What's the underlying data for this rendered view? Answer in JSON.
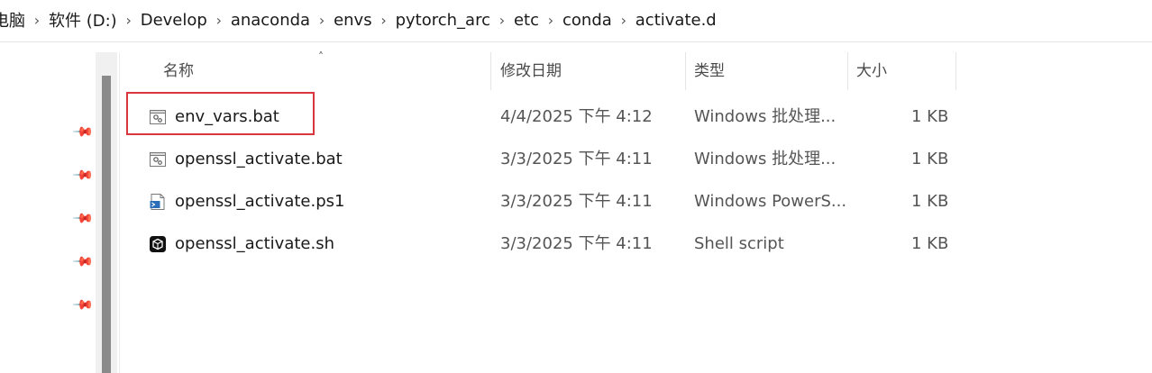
{
  "breadcrumb": {
    "items": [
      "电脑",
      "软件 (D:)",
      "Develop",
      "anaconda",
      "envs",
      "pytorch_arc",
      "etc",
      "conda",
      "activate.d"
    ],
    "separator": "›"
  },
  "columns": {
    "name": "名称",
    "modified": "修改日期",
    "type": "类型",
    "size": "大小"
  },
  "files": [
    {
      "name": "env_vars.bat",
      "modified": "4/4/2025 下午 4:12",
      "type": "Windows 批处理...",
      "size": "1 KB",
      "icon": "batch-file-icon"
    },
    {
      "name": "openssl_activate.bat",
      "modified": "3/3/2025 下午 4:11",
      "type": "Windows 批处理...",
      "size": "1 KB",
      "icon": "batch-file-icon"
    },
    {
      "name": "openssl_activate.ps1",
      "modified": "3/3/2025 下午 4:11",
      "type": "Windows PowerS...",
      "size": "1 KB",
      "icon": "powershell-file-icon"
    },
    {
      "name": "openssl_activate.sh",
      "modified": "3/3/2025 下午 4:11",
      "type": "Shell script",
      "size": "1 KB",
      "icon": "shell-script-icon"
    }
  ],
  "colors": {
    "highlight": "#d9363e",
    "scroll_thumb": "#8a8a8a"
  }
}
